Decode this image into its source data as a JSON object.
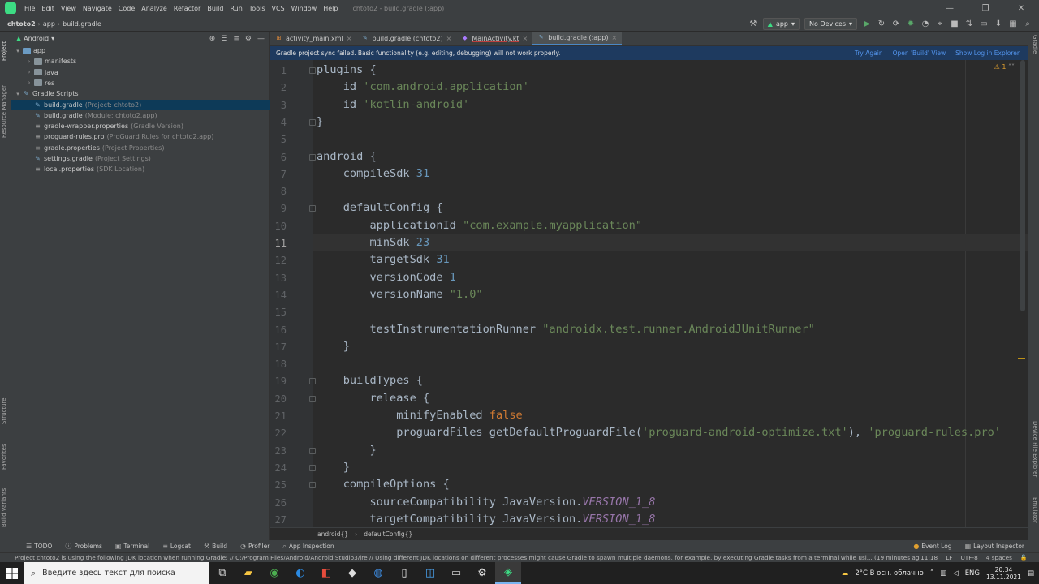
{
  "menubar": {
    "items": [
      "File",
      "Edit",
      "View",
      "Navigate",
      "Code",
      "Analyze",
      "Refactor",
      "Build",
      "Run",
      "Tools",
      "VCS",
      "Window",
      "Help"
    ],
    "window_title": "chtoto2 - build.gradle (:app)"
  },
  "navbar": {
    "crumbs": [
      "chtoto2",
      "app",
      "build.gradle"
    ]
  },
  "toolbar": {
    "run_config": "app",
    "device": "No Devices"
  },
  "project_panel": {
    "view_mode": "Android",
    "tree": [
      {
        "label": "app",
        "hint": "",
        "level": 0,
        "kind": "folder-blue",
        "expanded": true,
        "selected": false
      },
      {
        "label": "manifests",
        "hint": "",
        "level": 1,
        "kind": "folder",
        "expanded": false,
        "selected": false
      },
      {
        "label": "java",
        "hint": "",
        "level": 1,
        "kind": "folder",
        "expanded": false,
        "selected": false
      },
      {
        "label": "res",
        "hint": "",
        "level": 1,
        "kind": "folder",
        "expanded": false,
        "selected": false
      },
      {
        "label": "Gradle Scripts",
        "hint": "",
        "level": 0,
        "kind": "gradle",
        "expanded": true,
        "selected": false
      },
      {
        "label": "build.gradle",
        "hint": "(Project: chtoto2)",
        "level": 1,
        "kind": "gradle",
        "expanded": null,
        "selected": true
      },
      {
        "label": "build.gradle",
        "hint": "(Module: chtoto2.app)",
        "level": 1,
        "kind": "gradle",
        "expanded": null,
        "selected": false
      },
      {
        "label": "gradle-wrapper.properties",
        "hint": "(Gradle Version)",
        "level": 1,
        "kind": "props",
        "expanded": null,
        "selected": false
      },
      {
        "label": "proguard-rules.pro",
        "hint": "(ProGuard Rules for chtoto2.app)",
        "level": 1,
        "kind": "props",
        "expanded": null,
        "selected": false
      },
      {
        "label": "gradle.properties",
        "hint": "(Project Properties)",
        "level": 1,
        "kind": "props",
        "expanded": null,
        "selected": false
      },
      {
        "label": "settings.gradle",
        "hint": "(Project Settings)",
        "level": 1,
        "kind": "gradle",
        "expanded": null,
        "selected": false
      },
      {
        "label": "local.properties",
        "hint": "(SDK Location)",
        "level": 1,
        "kind": "props",
        "expanded": null,
        "selected": false
      }
    ]
  },
  "left_strip": [
    "Project",
    "Resource Manager",
    "Structure",
    "Favorites",
    "Build Variants"
  ],
  "right_strip": [
    "Gradle",
    "Device File Explorer",
    "Emulator"
  ],
  "tabs": [
    {
      "label": "activity_main.xml",
      "active": false,
      "icon": "xml-icon"
    },
    {
      "label": "build.gradle (chtoto2)",
      "active": false,
      "icon": "gradle-icon"
    },
    {
      "label": "MainActivity.kt",
      "active": false,
      "icon": "kotlin-icon"
    },
    {
      "label": "build.gradle (:app)",
      "active": true,
      "icon": "gradle-icon"
    }
  ],
  "banner": {
    "message": "Gradle project sync failed. Basic functionality (e.g. editing, debugging) will not work properly.",
    "links": [
      "Try Again",
      "Open 'Build' View",
      "Show Log in Explorer"
    ]
  },
  "editor": {
    "warning_count": "1",
    "current_line": 11,
    "lines": [
      [
        [
          "plugins {",
          "p"
        ]
      ],
      [
        [
          "    id ",
          "p"
        ],
        [
          "'com.android.application'",
          "s"
        ]
      ],
      [
        [
          "    id ",
          "p"
        ],
        [
          "'kotlin-android'",
          "s"
        ]
      ],
      [
        [
          "}",
          "p"
        ]
      ],
      [
        [
          "",
          "p"
        ]
      ],
      [
        [
          "android {",
          "p"
        ]
      ],
      [
        [
          "    compileSdk ",
          "p"
        ],
        [
          "31",
          "n"
        ]
      ],
      [
        [
          "",
          "p"
        ]
      ],
      [
        [
          "    defaultConfig {",
          "p"
        ]
      ],
      [
        [
          "        applicationId ",
          "p"
        ],
        [
          "\"com.example.myapplication\"",
          "s"
        ]
      ],
      [
        [
          "        minSdk ",
          "p"
        ],
        [
          "23",
          "n"
        ]
      ],
      [
        [
          "        targetSdk ",
          "p"
        ],
        [
          "31",
          "n"
        ]
      ],
      [
        [
          "        versionCode ",
          "p"
        ],
        [
          "1",
          "n"
        ]
      ],
      [
        [
          "        versionName ",
          "p"
        ],
        [
          "\"1.0\"",
          "s"
        ]
      ],
      [
        [
          "",
          "p"
        ]
      ],
      [
        [
          "        testInstrumentationRunner ",
          "p"
        ],
        [
          "\"androidx.test.runner.AndroidJUnitRunner\"",
          "s"
        ]
      ],
      [
        [
          "    }",
          "p"
        ]
      ],
      [
        [
          "",
          "p"
        ]
      ],
      [
        [
          "    buildTypes {",
          "p"
        ]
      ],
      [
        [
          "        release {",
          "p"
        ]
      ],
      [
        [
          "            minifyEnabled ",
          "p"
        ],
        [
          "false",
          "k"
        ]
      ],
      [
        [
          "            proguardFiles getDefaultProguardFile(",
          "p"
        ],
        [
          "'proguard-android-optimize.txt'",
          "s"
        ],
        [
          "), ",
          "p"
        ],
        [
          "'proguard-rules.pro'",
          "s"
        ]
      ],
      [
        [
          "        }",
          "p"
        ]
      ],
      [
        [
          "    }",
          "p"
        ]
      ],
      [
        [
          "    compileOptions {",
          "p"
        ]
      ],
      [
        [
          "        sourceCompatibility JavaVersion.",
          "p"
        ],
        [
          "VERSION_1_8",
          "i"
        ]
      ],
      [
        [
          "        targetCompatibility JavaVersion.",
          "p"
        ],
        [
          "VERSION_1_8",
          "i"
        ]
      ]
    ]
  },
  "crumb_bar": [
    "android{}",
    "defaultConfig{}"
  ],
  "tool_windows_left": [
    "TODO",
    "Problems",
    "Terminal",
    "Logcat",
    "Build",
    "Profiler",
    "App Inspection"
  ],
  "tool_windows_right": [
    "Event Log",
    "Layout Inspector"
  ],
  "status": {
    "message": "Project chtoto2 is using the following JDK location when running Gradle: // C:/Program Files/Android/Android Studio3/jre // Using different JDK locations on different processes might cause Gradle to spawn multiple daemons, for example, by executing Gradle tasks from a terminal while usi... (19 minutes ago)",
    "position": "11:18",
    "line_sep": "LF",
    "encoding": "UTF-8",
    "indent": "4 spaces"
  },
  "taskbar": {
    "search_placeholder": "Введите здесь текст для поиска",
    "weather": "2°C  В осн. облачно",
    "lang": "ENG",
    "time": "20:34",
    "date": "13.11.2021"
  },
  "colors": {
    "keyword": "#cc7832",
    "string": "#6a8759",
    "number": "#6897bb",
    "identifier": "#9876aa",
    "accent": "#4a88c7"
  }
}
